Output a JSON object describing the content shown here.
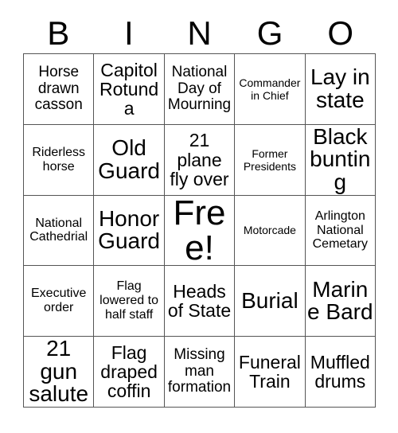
{
  "card": {
    "title": "BINGO",
    "header_letters": [
      "B",
      "I",
      "N",
      "G",
      "O"
    ],
    "free_space_label": "Free!",
    "colors": {
      "border": "#555555",
      "background": "#ffffff",
      "text": "#000000"
    },
    "rows": [
      [
        {
          "text": "Horse drawn casson",
          "size": "md"
        },
        {
          "text": "Capitol Rotunda",
          "size": "lg"
        },
        {
          "text": "National Day of Mourning",
          "size": "md"
        },
        {
          "text": "Commander in Chief",
          "size": "xs"
        },
        {
          "text": "Lay in state",
          "size": "xl"
        }
      ],
      [
        {
          "text": "Riderless horse",
          "size": "sm"
        },
        {
          "text": "Old Guard",
          "size": "xl"
        },
        {
          "text": "21 plane fly over",
          "size": "lg"
        },
        {
          "text": "Former Presidents",
          "size": "xs"
        },
        {
          "text": "Black bunting",
          "size": "xl"
        }
      ],
      [
        {
          "text": "National Cathedrial",
          "size": "sm"
        },
        {
          "text": "Honor Guard",
          "size": "xl"
        },
        {
          "text": "Free!",
          "size": "xxl"
        },
        {
          "text": "Motorcade",
          "size": "xs"
        },
        {
          "text": "Arlington National Cemetary",
          "size": "sm"
        }
      ],
      [
        {
          "text": "Executive order",
          "size": "sm"
        },
        {
          "text": "Flag lowered to half staff",
          "size": "sm"
        },
        {
          "text": "Heads of State",
          "size": "lg"
        },
        {
          "text": "Burial",
          "size": "xl"
        },
        {
          "text": "Marine Bard",
          "size": "xl"
        }
      ],
      [
        {
          "text": "21 gun salute",
          "size": "xl"
        },
        {
          "text": "Flag draped coffin",
          "size": "lg"
        },
        {
          "text": "Missing man formation",
          "size": "md"
        },
        {
          "text": "Funeral Train",
          "size": "lg"
        },
        {
          "text": "Muffled drums",
          "size": "lg"
        }
      ]
    ]
  }
}
